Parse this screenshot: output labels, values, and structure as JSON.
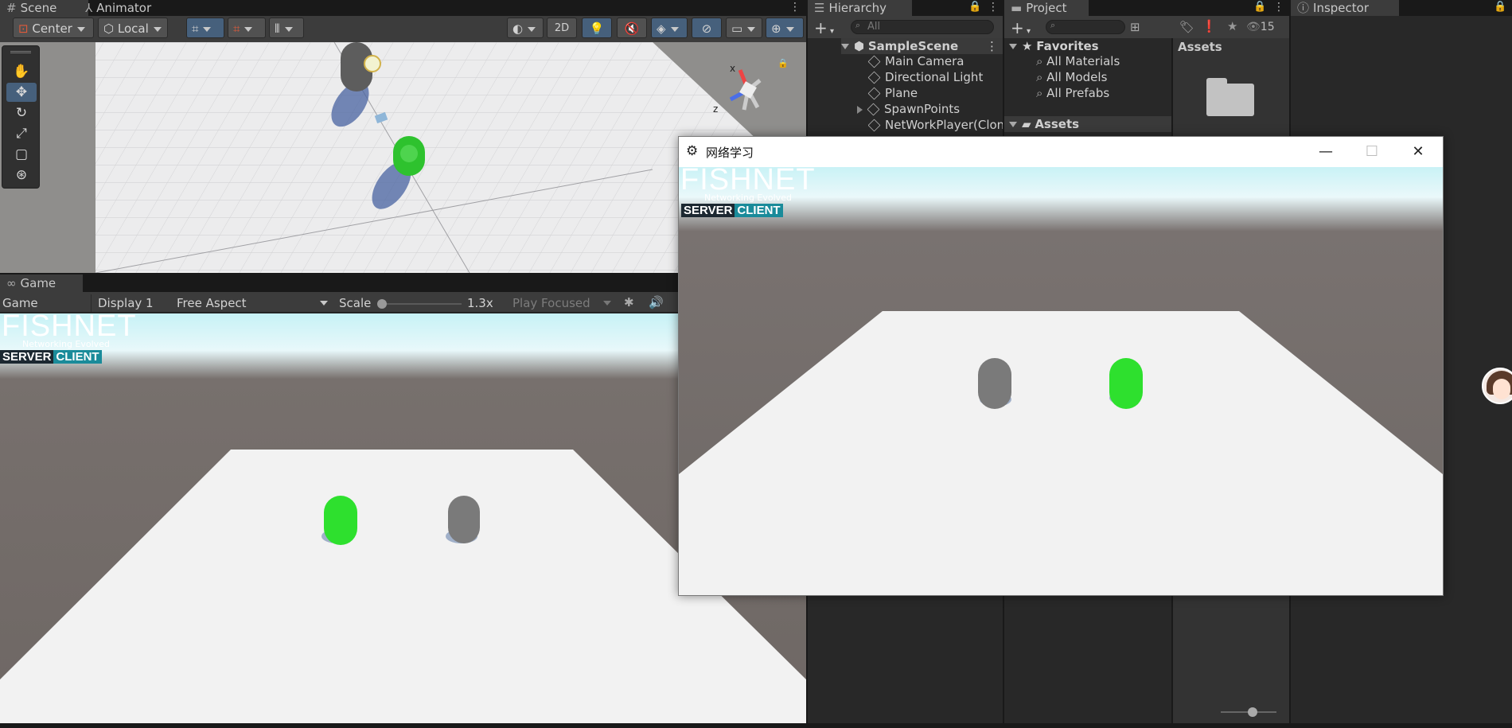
{
  "scene_panel": {
    "tabs": [
      {
        "label": "Scene",
        "icon": "grid-icon"
      },
      {
        "label": "Animator",
        "icon": "animator-icon"
      }
    ],
    "toolbar": {
      "pivot": "Center",
      "space": "Local",
      "mode_2d": "2D"
    },
    "gizmo": {
      "x": "x",
      "z": "z"
    }
  },
  "game_panel": {
    "tab": "Game",
    "toolbar": {
      "view": "Game",
      "display": "Display 1",
      "aspect": "Free Aspect",
      "scale_label": "Scale",
      "scale_value": "1.3x",
      "play_mode": "Play Focused"
    }
  },
  "overlay": {
    "logo": "FISHNET",
    "tagline": "Networking Evolved",
    "server": "SERVER",
    "client": "CLIENT"
  },
  "hierarchy": {
    "tab": "Hierarchy",
    "search_placeholder": "All",
    "scene": "SampleScene",
    "items": [
      "Main Camera",
      "Directional Light",
      "Plane",
      "SpawnPoints",
      "NetWorkPlayer(Clon"
    ]
  },
  "project": {
    "tab": "Project",
    "hidden_count": "15",
    "favorites_label": "Favorites",
    "favorites": [
      "All Materials",
      "All Models",
      "All Prefabs"
    ],
    "assets_label": "Assets",
    "assets_header": "Assets"
  },
  "inspector": {
    "tab": "Inspector"
  },
  "build_window": {
    "title": "网络学习"
  },
  "colors": {
    "accent": "#46607c",
    "player_green": "#2ee02e",
    "player_gray": "#7a7a7a",
    "client_badge": "#1a8b9a"
  }
}
